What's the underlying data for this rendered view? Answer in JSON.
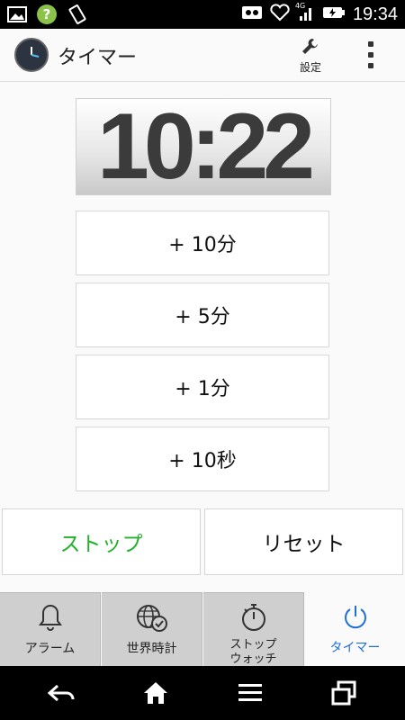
{
  "status_bar": {
    "time": "19:34",
    "network": "4G"
  },
  "app_bar": {
    "title": "タイマー",
    "settings_label": "設定"
  },
  "timer": {
    "display": "10:22"
  },
  "add_buttons": [
    "+ 10分",
    "+ 5分",
    "+ 1分",
    "+ 10秒"
  ],
  "controls": {
    "stop_label": "ストップ",
    "reset_label": "リセット",
    "stop_color": "#22b22a"
  },
  "tabs": [
    {
      "label": "アラーム",
      "icon": "bell-icon",
      "active": false
    },
    {
      "label": "世界時計",
      "icon": "globe-clock-icon",
      "active": false
    },
    {
      "label": "ストップ\nウォッチ",
      "icon": "stopwatch-icon",
      "active": false
    },
    {
      "label": "タイマー",
      "icon": "timer-power-icon",
      "active": true
    }
  ],
  "colors": {
    "accent": "#1e6fd6"
  }
}
